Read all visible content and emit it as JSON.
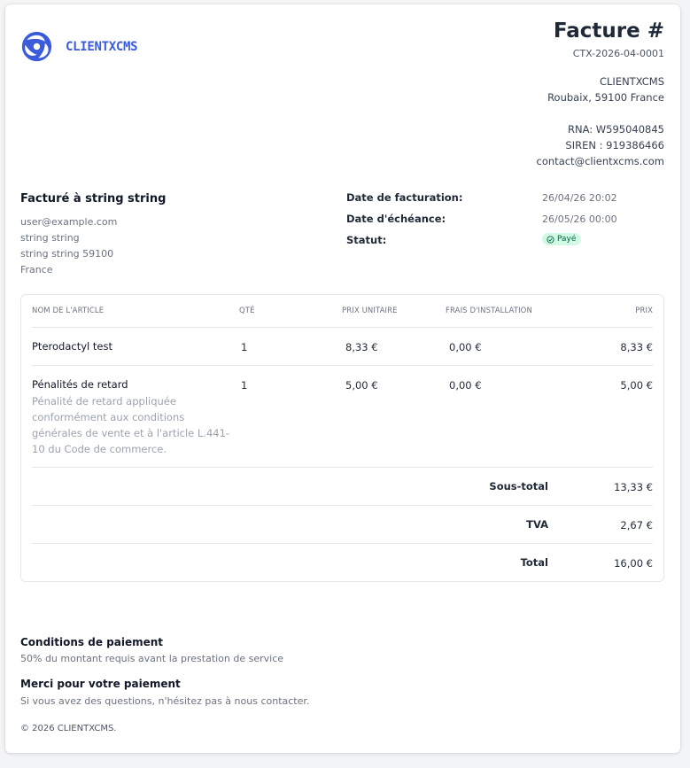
{
  "brand": {
    "name": "CLIENTXCMS",
    "accent": "#3b5bdb"
  },
  "invoice": {
    "title": "Facture #",
    "number": "CTX-2026-04-0001"
  },
  "company": {
    "name": "CLIENTXCMS",
    "address": "Roubaix, 59100 France",
    "rna": "RNA: W595040845",
    "siren": "SIREN : 919386466",
    "email": "contact@clientxcms.com"
  },
  "bill_to": {
    "title": "Facturé à string string",
    "email": "user@example.com",
    "name": "string string",
    "city": "string string 59100",
    "country": "France"
  },
  "meta": {
    "invoice_date_label": "Date de facturation:",
    "invoice_date": "26/04/26 20:02",
    "due_date_label": "Date d'échéance:",
    "due_date": "26/05/26 00:00",
    "status_label": "Statut:",
    "status": "Payé",
    "status_color": "#d1fae5"
  },
  "table": {
    "headers": {
      "name": "NOM DE L'ARTICLE",
      "qty": "QTÉ",
      "unit_price": "PRIX UNITAIRE",
      "setup_fee": "FRAIS D'INSTALLATION",
      "price": "PRIX"
    },
    "rows": [
      {
        "name": "Pterodactyl test",
        "description": "",
        "qty": "1",
        "unit_price": "8,33 €",
        "setup_fee": "0,00 €",
        "price": "8,33 €"
      },
      {
        "name": "Pénalités de retard",
        "description": "Pénalité de retard appliquée conformément aux conditions générales de vente et à l'article L.441-10 du Code de commerce.",
        "qty": "1",
        "unit_price": "5,00 €",
        "setup_fee": "0,00 €",
        "price": "5,00 €"
      }
    ],
    "totals": {
      "subtotal_label": "Sous-total",
      "subtotal": "13,33 €",
      "tax_label": "TVA",
      "tax": "2,67 €",
      "total_label": "Total",
      "total": "16,00 €"
    }
  },
  "footer": {
    "terms_title": "Conditions de paiement",
    "terms_text": "50% du montant requis avant la prestation de service",
    "thanks_title": "Merci pour votre paiement",
    "thanks_text": "Si vous avez des questions, n'hésitez pas à nous contacter.",
    "copyright": "© 2026 CLIENTXCMS."
  }
}
